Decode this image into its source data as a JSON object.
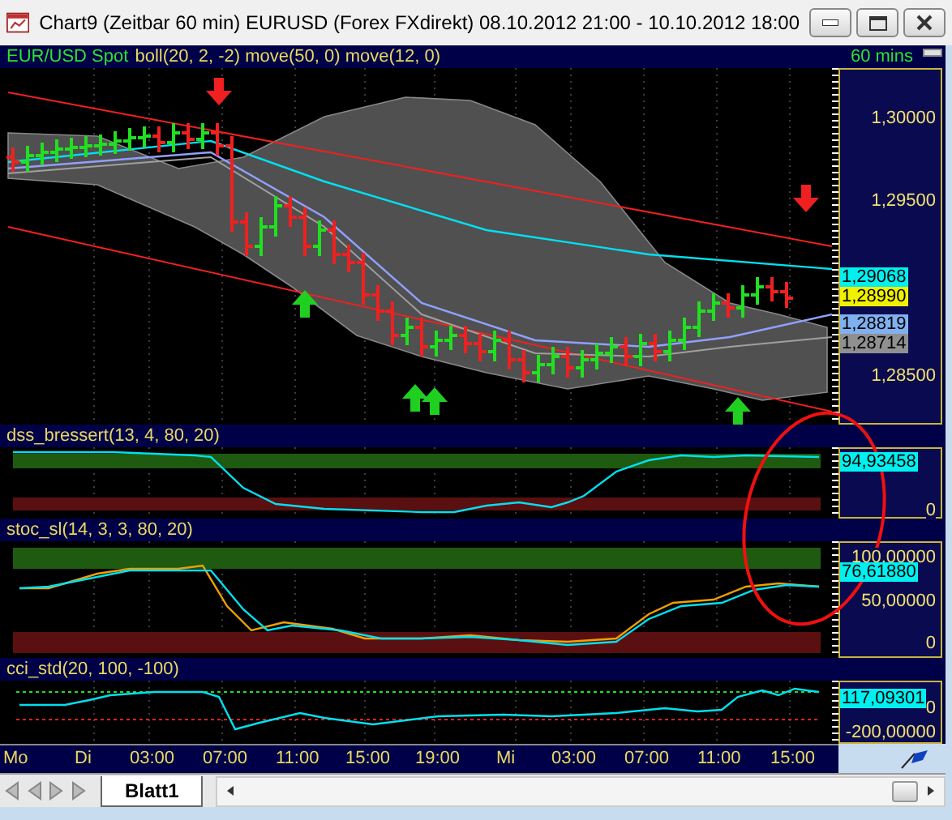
{
  "window": {
    "title": "Chart9 (Zeitbar 60 min)  EURUSD (Forex FXdirekt) 08.10.2012 21:00 - 10.10.2012 18:00"
  },
  "panels": [
    {
      "kind": "price",
      "instrument": "EUR/USD Spot",
      "indicators": "boll(20, 2, -2) move(50, 0) move(12, 0)",
      "interval": "60 mins",
      "axis_labels": [
        "1,30000",
        "1,29500",
        "1,28500"
      ],
      "badges": [
        {
          "text": "1,29068",
          "color": "#00f0f0"
        },
        {
          "text": "1,28990",
          "color": "#f0f000"
        },
        {
          "text": "1,28819",
          "color": "#80b0f0"
        },
        {
          "text": "1,28714",
          "color": "#909090"
        }
      ]
    },
    {
      "kind": "dss",
      "indicators": "dss_bressert(13, 4, 80, 20)",
      "axis_labels": [
        "0"
      ],
      "badges": [
        {
          "text": "94,93458",
          "color": "#00f0f0"
        }
      ]
    },
    {
      "kind": "stoch",
      "indicators": "stoc_sl(14, 3, 3, 80, 20)",
      "axis_labels": [
        "100,00000",
        "50,00000",
        "0"
      ],
      "badges": [
        {
          "text": "76,61880",
          "color": "#00f0f0"
        }
      ]
    },
    {
      "kind": "cci",
      "indicators": "cci_std(20, 100, -100)",
      "axis_labels": [
        "0",
        "-200,00000"
      ],
      "badges": [
        {
          "text": "117,09301",
          "color": "#00f0f0"
        }
      ]
    }
  ],
  "time_axis": [
    "Mo",
    "Di",
    "03:00",
    "07:00",
    "11:00",
    "15:00",
    "19:00",
    "Mi",
    "03:00",
    "07:00",
    "11:00",
    "15:00"
  ],
  "tabs": [
    {
      "label": "Blatt1",
      "selected": true
    }
  ]
}
